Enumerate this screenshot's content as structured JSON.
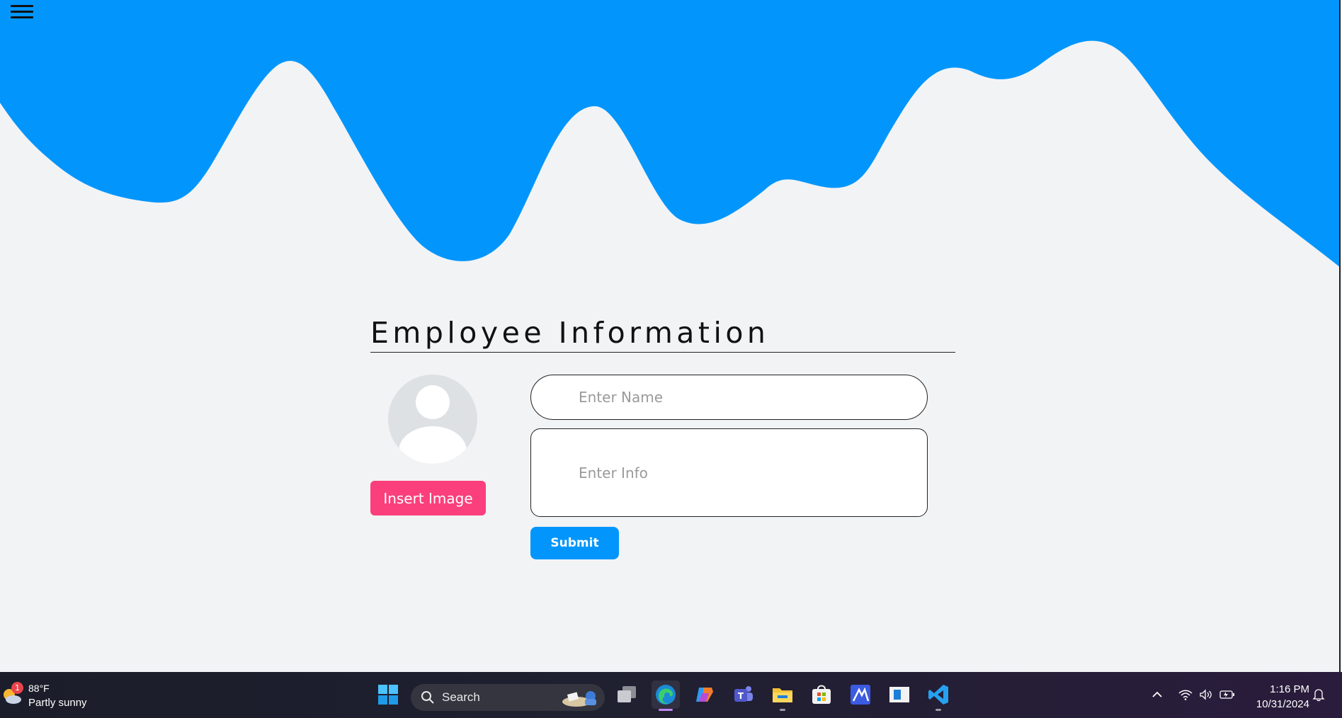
{
  "colors": {
    "wave": "#0296fc",
    "background": "#f2f3f5",
    "insert_button": "#fb3f7c",
    "submit_button": "#0296fc"
  },
  "header": {
    "menu_icon": "hamburger-icon"
  },
  "form": {
    "title": "Employee Information",
    "avatar_icon": "user-avatar-icon",
    "insert_image_label": "Insert Image",
    "name_placeholder": "Enter Name",
    "name_value": "",
    "info_placeholder": "Enter Info",
    "info_value": "",
    "submit_label": "Submit"
  },
  "taskbar": {
    "weather": {
      "badge": "1",
      "temperature": "88°F",
      "condition": "Partly sunny",
      "icon": "partly-sunny-icon"
    },
    "start_icon": "windows-start-icon",
    "search_label": "Search",
    "apps": [
      {
        "name": "task-view-icon"
      },
      {
        "name": "edge-icon",
        "active": true
      },
      {
        "name": "copilot-icon"
      },
      {
        "name": "teams-icon"
      },
      {
        "name": "file-explorer-icon"
      },
      {
        "name": "microsoft-store-icon"
      },
      {
        "name": "app-icon"
      },
      {
        "name": "window-app-icon"
      },
      {
        "name": "vscode-icon"
      }
    ],
    "tray": [
      "chevron-up-icon",
      "wifi-icon",
      "volume-icon",
      "battery-icon",
      "notification-bell-icon"
    ],
    "clock": {
      "time": "1:16 PM",
      "date": "10/31/2024"
    }
  }
}
